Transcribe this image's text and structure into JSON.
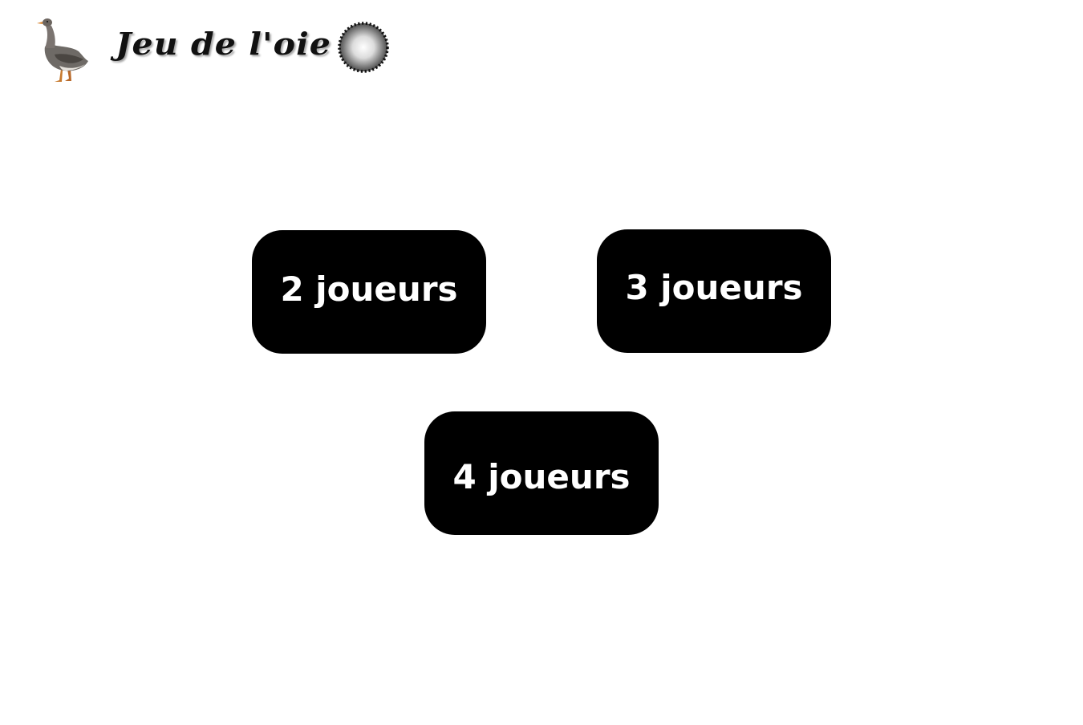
{
  "header": {
    "title": "Jeu de l'oie",
    "logo_icon": "goose-icon",
    "pawn_icon": "pawn-token-icon"
  },
  "player_buttons": [
    {
      "label": "2 joueurs"
    },
    {
      "label": "3 joueurs"
    },
    {
      "label": "4 joueurs"
    }
  ],
  "colors": {
    "button_background": "#000000",
    "button_text": "#ffffff",
    "page_background": "#ffffff"
  }
}
